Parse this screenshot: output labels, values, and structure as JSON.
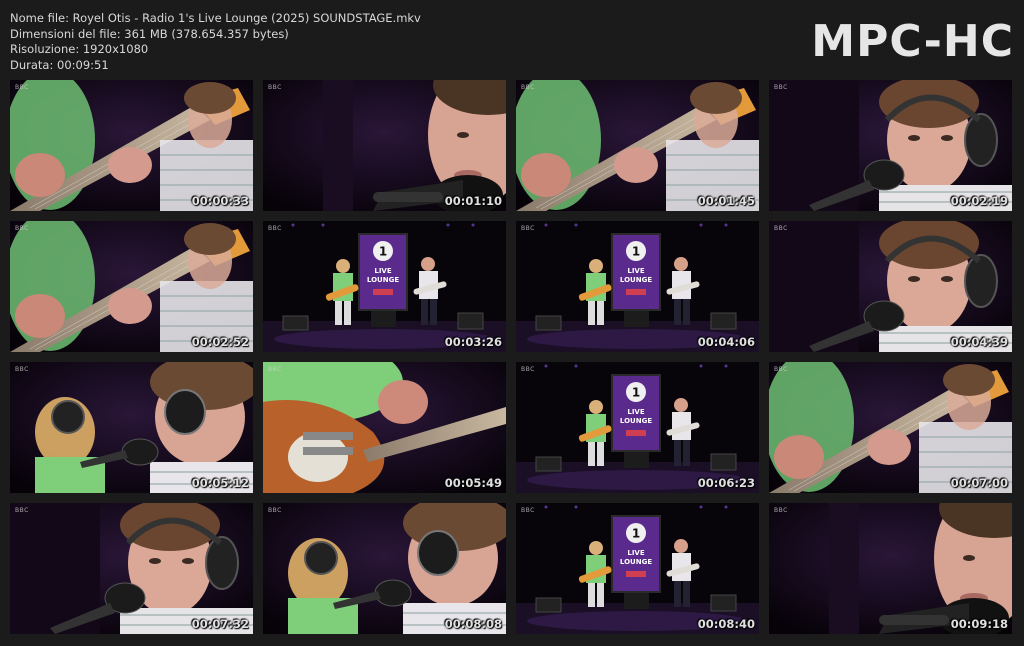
{
  "info": {
    "filename": "Nome file: Royel Otis - Radio 1's Live Lounge (2025) SOUNDSTAGE.mkv",
    "filesize": "Dimensioni del file: 361 MB (378.654.357 bytes)",
    "resolution": "Risoluzione: 1920x1080",
    "duration": "Durata: 00:09:51"
  },
  "logo": "MPC-HC",
  "watermark": "BBC",
  "thumbnails": [
    {
      "time": "00:00:33",
      "scene": "guitar-closeup"
    },
    {
      "time": "00:01:10",
      "scene": "face-closeup"
    },
    {
      "time": "00:01:45",
      "scene": "guitar-closeup"
    },
    {
      "time": "00:02:19",
      "scene": "singer-headphones"
    },
    {
      "time": "00:02:52",
      "scene": "guitar-closeup"
    },
    {
      "time": "00:03:26",
      "scene": "wide-stage"
    },
    {
      "time": "00:04:06",
      "scene": "wide-stage"
    },
    {
      "time": "00:04:39",
      "scene": "singer-headphones"
    },
    {
      "time": "00:05:12",
      "scene": "two-singers"
    },
    {
      "time": "00:05:49",
      "scene": "guitar-body"
    },
    {
      "time": "00:06:23",
      "scene": "wide-stage"
    },
    {
      "time": "00:07:00",
      "scene": "guitar-closeup"
    },
    {
      "time": "00:07:32",
      "scene": "singer-headphones"
    },
    {
      "time": "00:08:08",
      "scene": "two-singers"
    },
    {
      "time": "00:08:40",
      "scene": "wide-stage"
    },
    {
      "time": "00:09:18",
      "scene": "face-closeup"
    }
  ],
  "stage_sign": {
    "number": "1",
    "line1": "LIVE",
    "line2": "LOUNGE"
  },
  "colors": {
    "background": "#1b1b1b",
    "stage_purple": "#5a2a8c",
    "green_shirt": "#7fcf7a",
    "guitar_orange": "#e39a3a"
  }
}
